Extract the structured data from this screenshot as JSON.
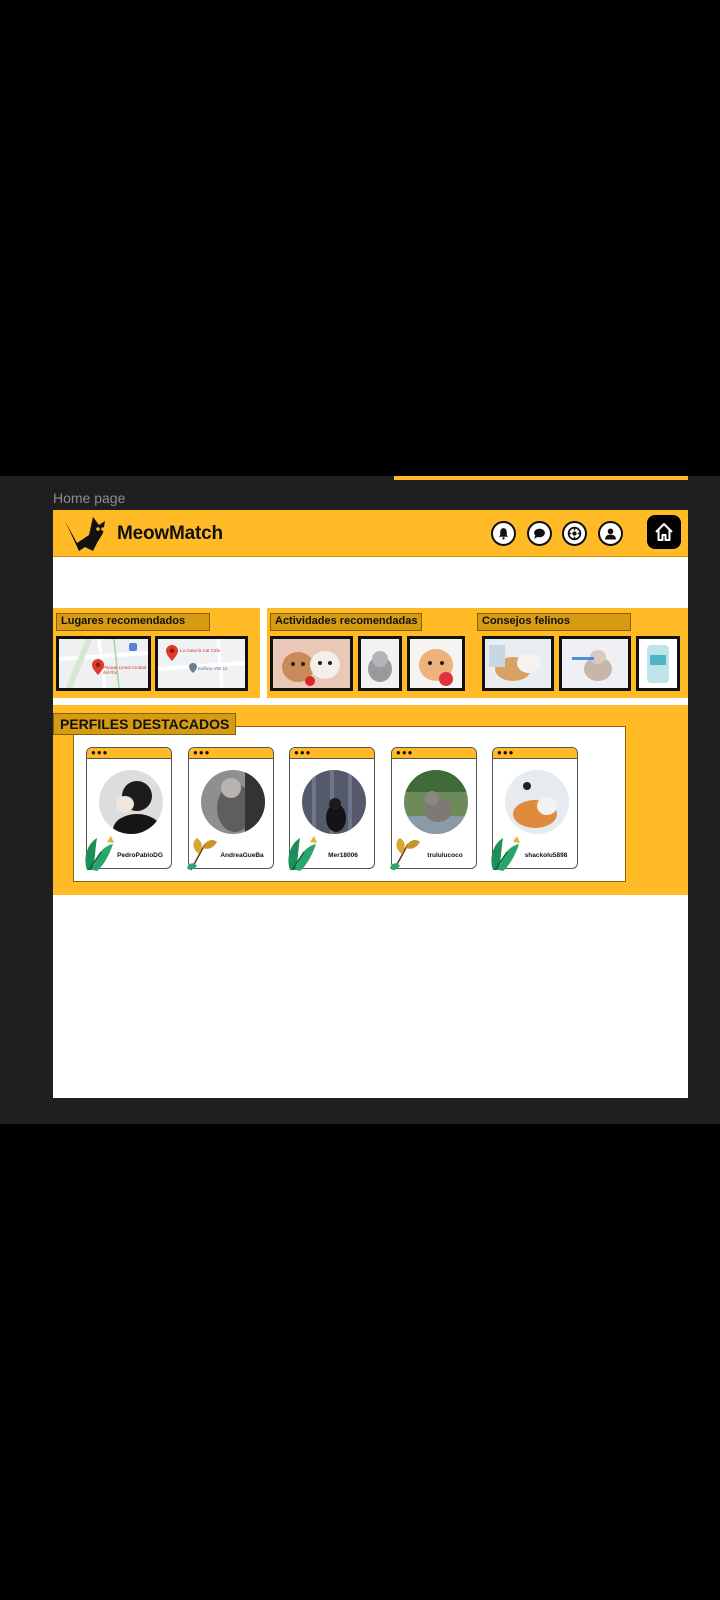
{
  "frame_label": "Home page",
  "brand": {
    "name": "MeowMatch"
  },
  "header_icons": [
    "bell-icon",
    "chat-icon",
    "settings-icon",
    "user-icon",
    "home-icon"
  ],
  "sections": [
    {
      "title": "Lugares recomendados",
      "map_labels": [
        "Parque Lineal Ciudad del Río",
        "La Gatería Cat Cafe",
        "Edificio Vita 11"
      ]
    },
    {
      "title": "Actividades recomendadas"
    },
    {
      "title": "Consejos felinos"
    }
  ],
  "profiles": {
    "title": "PERFILES DESTACADOS",
    "users": [
      "PedroPabloDG",
      "AndreaGueBa",
      "Mer18006",
      "trululucoco",
      "shackolu5898"
    ]
  },
  "colors": {
    "accent": "#FFBA25",
    "dark": "#111111"
  }
}
